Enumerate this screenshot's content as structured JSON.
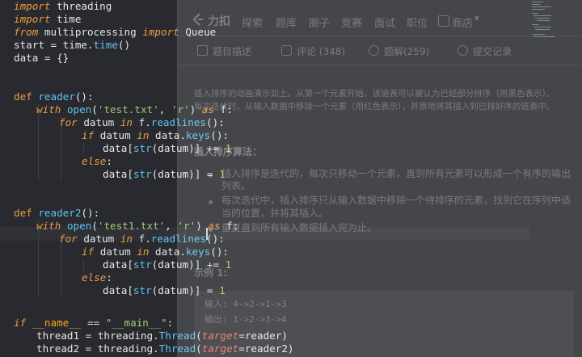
{
  "code": {
    "line1": {
      "kw": "import",
      "rest": " threading"
    },
    "line2": {
      "kw": "import",
      "rest": " time"
    },
    "line3": {
      "kw1": "from",
      "mid": " multiprocessing ",
      "kw2": "import",
      "rest": " Queue"
    },
    "line4": {
      "a": "start = time.",
      "fn": "time",
      "b": "()"
    },
    "line5": {
      "text": "data = {}"
    },
    "line8": {
      "kw": "def",
      "fn": " reader",
      "rest": "():"
    },
    "line9": {
      "kw": "with",
      "sp": " ",
      "fn": "open",
      "p1": "(",
      "s1": "'test.txt'",
      "c": ", ",
      "s2": "'r'",
      "p2": ") ",
      "kw2": "as",
      "rest": " f:"
    },
    "line10": {
      "kw": "for",
      "a": " datum ",
      "kw2": "in",
      "b": " f.",
      "fn": "readlines",
      "c": "():"
    },
    "line11": {
      "kw": "if",
      "a": " datum ",
      "kw2": "in",
      "b": " data.",
      "fn": "keys",
      "c": "():"
    },
    "line12": {
      "a": "data[",
      "fn": "str",
      "b": "(datum)] += ",
      "n": "1"
    },
    "line13": {
      "kw": "else",
      "rest": ":"
    },
    "line14": {
      "a": "data[",
      "fn": "str",
      "b": "(datum)] = ",
      "n": "1"
    },
    "line17": {
      "kw": "def",
      "fn": " reader2",
      "rest": "():"
    },
    "line18": {
      "kw": "with",
      "sp": " ",
      "fn": "open",
      "p1": "(",
      "s1": "'test1.txt'",
      "c": ", ",
      "s2": "'r'",
      "p2": ") ",
      "kw2": "as",
      "rest": " f:"
    },
    "line19": {
      "kw": "for",
      "a": " datum ",
      "kw2": "in",
      "b": " f.",
      "fn": "readlines",
      "c": "():"
    },
    "line20": {
      "kw": "if",
      "a": " datum ",
      "kw2": "in",
      "b": " data.",
      "fn": "keys",
      "c": "():"
    },
    "line21": {
      "a": "data[",
      "fn": "str",
      "b": "(datum)] += ",
      "n": "1"
    },
    "line22": {
      "kw": "else",
      "rest": ":"
    },
    "line23": {
      "a": "data[",
      "fn": "str",
      "b": "(datum)] = ",
      "n": "1"
    },
    "line26": {
      "kw": "if",
      "sp": " ",
      "dunder": "__name__",
      "eq": " == ",
      "s": "\"__main__\"",
      "rest": ":"
    },
    "line27": {
      "a": "thread1 = threading.",
      "cl": "Thread",
      "p": "(",
      "param": "target",
      "b": "=reader)"
    },
    "line28": {
      "a": "thread2 = threading.",
      "cl": "Thread",
      "p": "(",
      "param": "target",
      "b": "=reader2)"
    }
  },
  "overlay": {
    "logo": "力扣",
    "nav": [
      "探索",
      "题库",
      "圈子",
      "竞赛",
      "面试",
      "职位",
      "商店"
    ],
    "tabs": [
      "题目描述",
      "评论 (348)",
      "题解(259)",
      "提交记录"
    ],
    "intro1": "插入排序的动画演示如上。从第一个元素开始，该链表可以被认为已经部分排序（用黑色表示）。",
    "intro2": "每次迭代时，从输入数据中移除一个元素（用红色表示），并原地将其插入到已排好序的链表中。",
    "algo_title": "插入排序算法：",
    "bullets": [
      "插入排序是迭代的，每次只移动一个元素，直到所有元素可以形成一个有序的输出",
      "列表。",
      "每次迭代中，插入排序只从输入数据中移除一个待排序的元素，找到它在序列中适",
      "当的位置，并将其插入。",
      "重复直到所有输入数据插入完为止。"
    ],
    "example_title": "示例 1:",
    "input": "输入: 4->2->1->3",
    "output": "输出: 1->2->3->4"
  },
  "colors": {
    "editor_bg": "#282a2f",
    "keyword": "#ec9c3f",
    "function": "#5ec4f0",
    "string": "#a3c97a",
    "number": "#d9b25a"
  }
}
